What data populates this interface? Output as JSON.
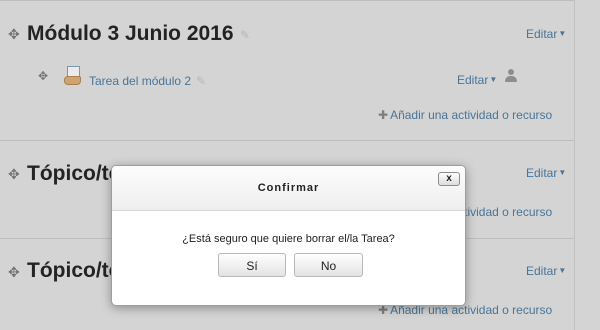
{
  "sections": [
    {
      "title": "Módulo 3 Junio 2016",
      "edit_label": "Editar",
      "activity": {
        "name": "Tarea del módulo 2",
        "edit_label": "Editar"
      },
      "add_label": "Añadir una actividad o recurso"
    },
    {
      "title": "Tópico/to",
      "edit_label": "Editar",
      "add_label": "Añadir una actividad o recurso"
    },
    {
      "title": "Tópico/to",
      "edit_label": "Editar",
      "add_label": "Añadir una actividad o recurso"
    }
  ],
  "dialog": {
    "title": "Confirmar",
    "close_label": "x",
    "question": "¿Está seguro que quiere borrar el/la Tarea?",
    "yes_label": "Sí",
    "no_label": "No"
  },
  "icons": {
    "move": "move-icon",
    "edit_title": "pencil-icon",
    "activity": "assignment-icon",
    "user": "user-icon",
    "add": "plus-icon"
  },
  "colors": {
    "link": "#4f7fa6",
    "background": "#e6e6e6",
    "dialog_bg": "#ffffff"
  }
}
